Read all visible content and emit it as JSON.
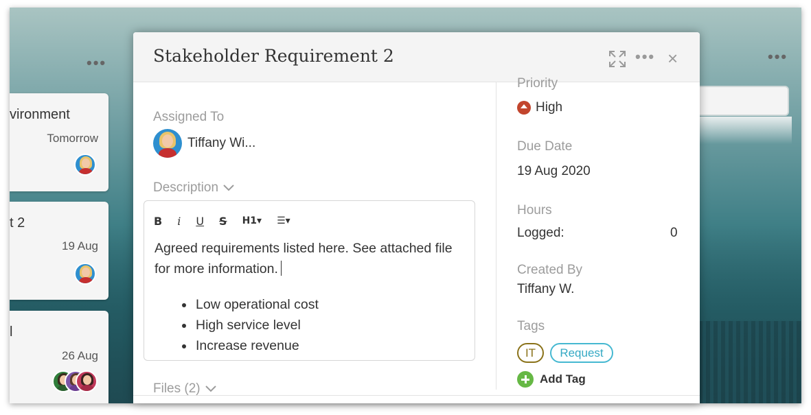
{
  "board": {
    "left_cards": [
      {
        "title": "vironment",
        "date": "Tomorrow"
      },
      {
        "title": "t 2",
        "date": "19 Aug"
      },
      {
        "title": "l",
        "date": "26 Aug"
      }
    ],
    "column_menu": "•••"
  },
  "modal": {
    "title": "Stakeholder Requirement 2",
    "header_icons": [
      "expand-icon",
      "more-icon",
      "close-icon"
    ],
    "more_label": "•••",
    "close_label": "×",
    "assigned_to_label": "Assigned To",
    "assignee_name": "Tiffany Wi...",
    "description_label": "Description",
    "editor": {
      "toolbar": {
        "bold": "B",
        "italic": "i",
        "underline": "U",
        "strike": "S",
        "heading": "H1▾",
        "list": "☰▾"
      },
      "text": "Agreed requirements listed here. See attached file for more information.",
      "bullets": [
        "Low operational cost",
        "High service level",
        "Increase revenue"
      ]
    },
    "files_label": "Files (2)",
    "priority_label": "Priority",
    "priority_value": "High",
    "priority_color": "#c2452d",
    "due_date_label": "Due Date",
    "due_date_value": "19 Aug 2020",
    "hours_label": "Hours",
    "logged_label": "Logged:",
    "logged_value": "0",
    "created_by_label": "Created By",
    "created_by_value": "Tiffany W.",
    "tags_label": "Tags",
    "tags": [
      {
        "label": "IT",
        "color": "#8a7219"
      },
      {
        "label": "Request",
        "color": "#45b8d1"
      }
    ],
    "add_tag_label": "Add Tag"
  }
}
